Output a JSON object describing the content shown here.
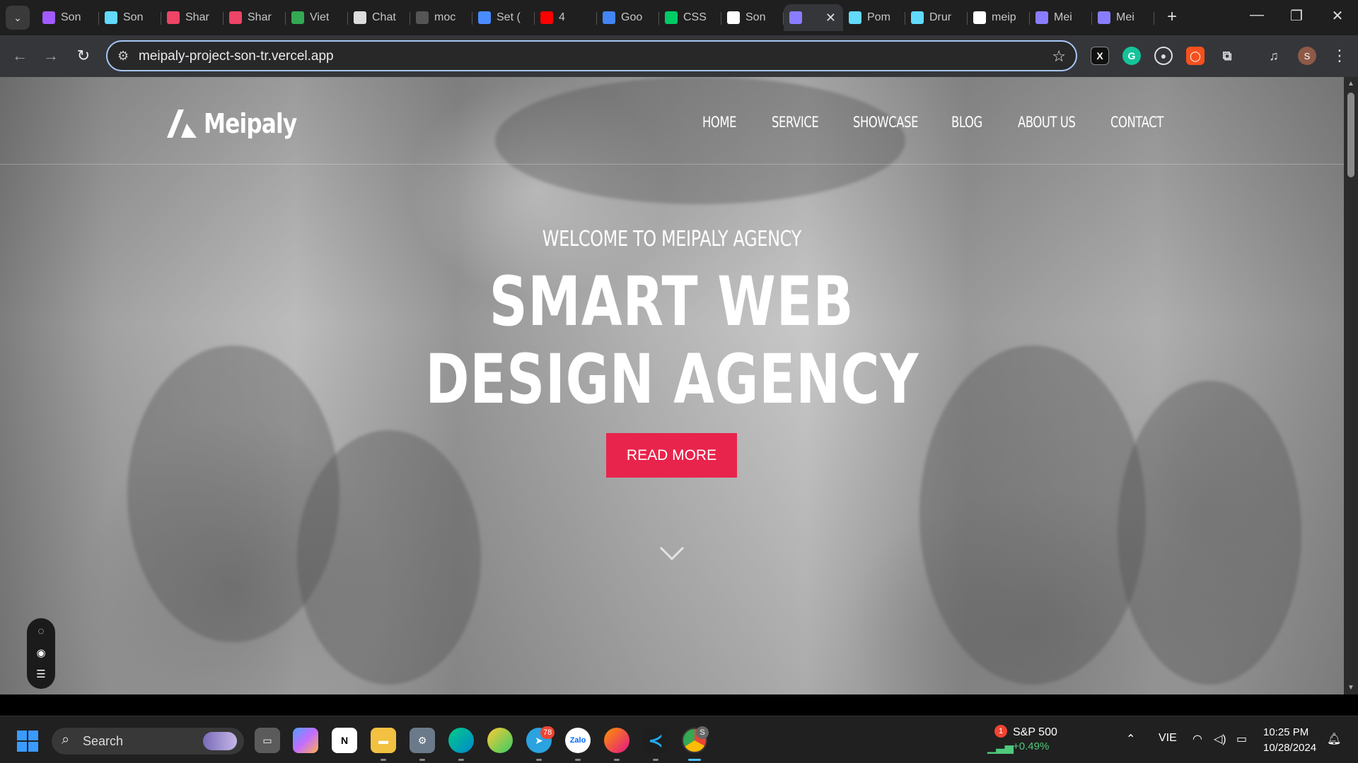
{
  "browser": {
    "tabs": [
      {
        "title": "Son",
        "icon": "infinity-icon",
        "color": "#a259ff"
      },
      {
        "title": "Son",
        "icon": "react-icon",
        "color": "#61dafb"
      },
      {
        "title": "Shar",
        "icon": "sv-icon",
        "color": "#e46"
      },
      {
        "title": "Shar",
        "icon": "sv-icon",
        "color": "#e46"
      },
      {
        "title": "Viet",
        "icon": "play-icon",
        "color": "#34a853"
      },
      {
        "title": "Chat",
        "icon": "chatgpt-icon",
        "color": "#ddd"
      },
      {
        "title": "moc",
        "icon": "api-icon",
        "color": "#555"
      },
      {
        "title": "Set (",
        "icon": "flag-icon",
        "color": "#4a8cff"
      },
      {
        "title": "4",
        "icon": "youtube-icon",
        "color": "#f00"
      },
      {
        "title": "Goo",
        "icon": "translate-icon",
        "color": "#4285f4"
      },
      {
        "title": "CSS",
        "icon": "w-icon",
        "color": "#0c6"
      },
      {
        "title": "Son",
        "icon": "github-icon",
        "color": "#fff"
      },
      {
        "title": "",
        "icon": "meipaly-icon",
        "color": "#8a7cff",
        "active": true
      },
      {
        "title": "Pom",
        "icon": "react-icon",
        "color": "#61dafb"
      },
      {
        "title": "Drur",
        "icon": "react-icon",
        "color": "#61dafb"
      },
      {
        "title": "meip",
        "icon": "vercel-icon",
        "color": "#fff"
      },
      {
        "title": "Mei",
        "icon": "meipaly-icon",
        "color": "#8a7cff"
      },
      {
        "title": "Mei",
        "icon": "meipaly-icon",
        "color": "#8a7cff"
      }
    ],
    "close_glyph": "✕",
    "new_tab_glyph": "+",
    "url": "meipaly-project-son-tr.vercel.app",
    "profile_initial": "S"
  },
  "site": {
    "logo": "Meipaly",
    "nav": [
      "HOME",
      "SERVICE",
      "SHOWCASE",
      "BLOG",
      "ABOUT US",
      "CONTACT"
    ],
    "welcome": "WELCOME TO MEIPALY AGENCY",
    "title_line1": "SMART WEB",
    "title_line2": "DESIGN AGENCY",
    "cta": "READ MORE",
    "accent": "#e8244c"
  },
  "taskbar": {
    "search_label": "Search",
    "telegram_badge": "78",
    "chrome_badge": "S",
    "stock": {
      "badge": "1",
      "name": "S&P 500",
      "change": "+0.49%"
    },
    "lang": "VIE",
    "time": "10:25 PM",
    "date": "10/28/2024"
  }
}
